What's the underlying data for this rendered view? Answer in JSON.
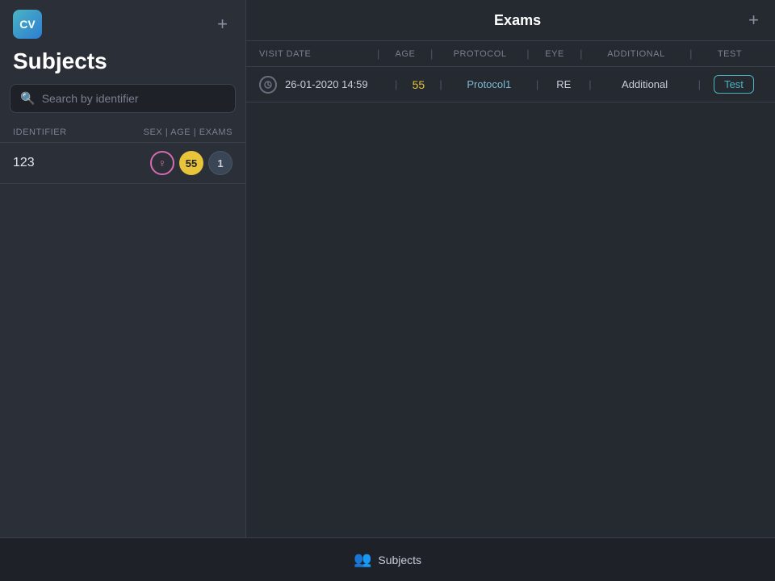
{
  "sidebar": {
    "logo_text": "CV",
    "add_label": "+",
    "title": "Subjects",
    "search_placeholder": "Search by identifier",
    "columns": {
      "identifier": "IDENTIFIER",
      "sex_age_exams": "SEX | AGE | EXAMS"
    },
    "subjects": [
      {
        "id": "123",
        "sex_icon": "♀",
        "age": "55",
        "exams": "1"
      }
    ]
  },
  "exams": {
    "title": "Exams",
    "add_label": "+",
    "columns": {
      "visit_date": "VISIT DATE",
      "age": "AGE",
      "protocol": "PROTOCOL",
      "eye": "EYE",
      "additional": "ADDITIONAL",
      "test": "TEST"
    },
    "rows": [
      {
        "date": "26-01-2020 14:59",
        "age": "55",
        "protocol": "Protocol1",
        "eye": "RE",
        "additional": "Additional",
        "test": "Test"
      }
    ]
  },
  "bottom_nav": {
    "label": "Subjects",
    "icon": "👥"
  }
}
